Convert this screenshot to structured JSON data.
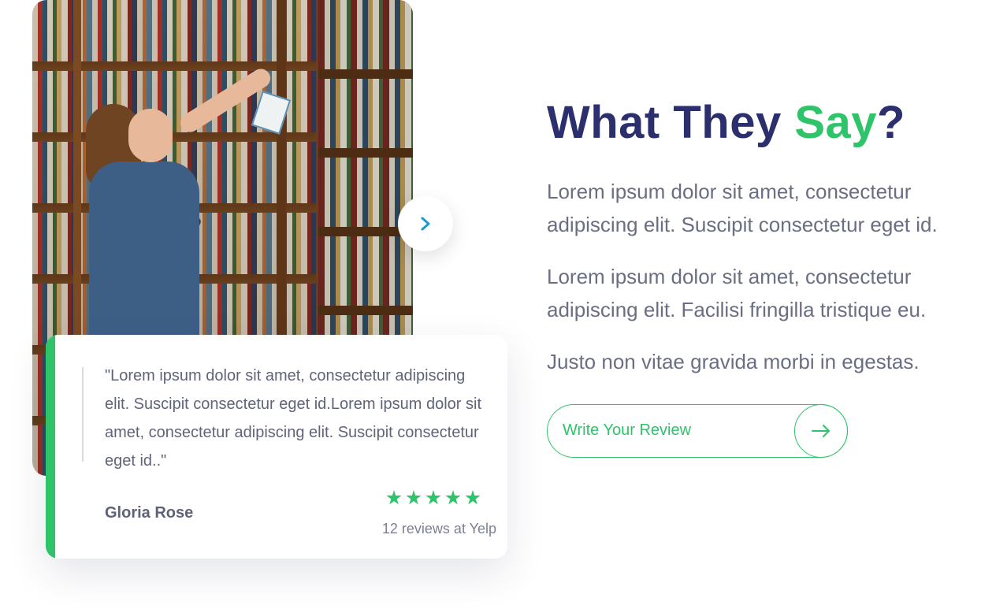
{
  "hero_image": {
    "alt": "Woman picking a book from a library shelf",
    "icon": "photo-bookshelf"
  },
  "carousel": {
    "next_icon": "chevron-right-icon",
    "accent_color": "#1a9bd0"
  },
  "review_card": {
    "quote": "\"Lorem ipsum dolor sit amet, consectetur adipiscing elit. Suscipit consectetur eget id.Lorem ipsum dolor sit amet, consectetur adipiscing elit. Suscipit consectetur eget id..\"",
    "reviewer_name": "Gloria Rose",
    "rating": 5,
    "rating_max": 5,
    "review_count_text": "12 reviews at Yelp",
    "accent_color": "#2fc46a"
  },
  "section": {
    "heading_prefix": "What They ",
    "heading_highlight": "Say",
    "heading_suffix": "?",
    "heading_color": "#2c2f6e",
    "highlight_color": "#2fc46a",
    "paragraphs": [
      "Lorem ipsum dolor sit amet, consectetur adipiscing elit. Suscipit consectetur eget id.",
      "Lorem ipsum dolor sit amet, consectetur adipiscing elit. Facilisi fringilla tristique eu.",
      "Justo non vitae gravida morbi in egestas."
    ]
  },
  "cta": {
    "label": "Write Your Review",
    "icon": "arrow-right-icon",
    "color": "#2fc46a"
  }
}
